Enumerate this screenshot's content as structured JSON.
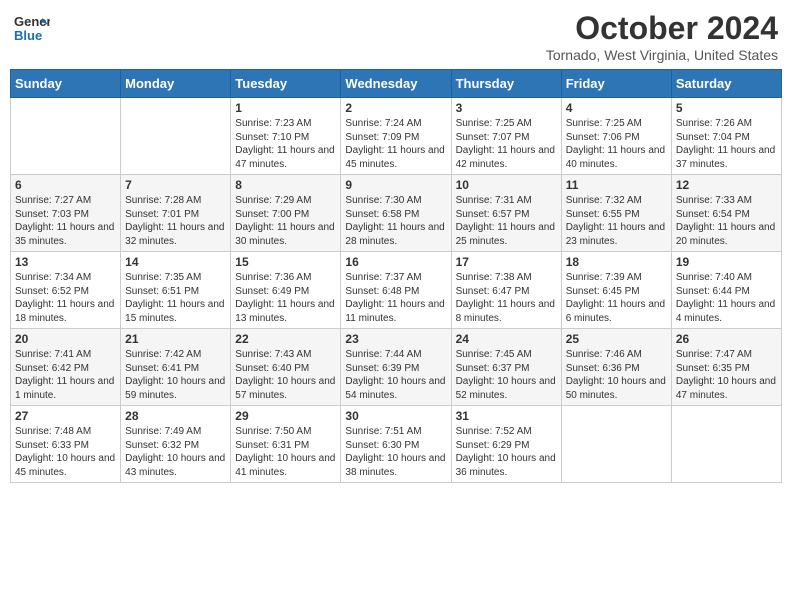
{
  "header": {
    "logo_line1": "General",
    "logo_line2": "Blue",
    "month": "October 2024",
    "location": "Tornado, West Virginia, United States"
  },
  "weekdays": [
    "Sunday",
    "Monday",
    "Tuesday",
    "Wednesday",
    "Thursday",
    "Friday",
    "Saturday"
  ],
  "weeks": [
    [
      {
        "day": "",
        "sunrise": "",
        "sunset": "",
        "daylight": ""
      },
      {
        "day": "",
        "sunrise": "",
        "sunset": "",
        "daylight": ""
      },
      {
        "day": "1",
        "sunrise": "Sunrise: 7:23 AM",
        "sunset": "Sunset: 7:10 PM",
        "daylight": "Daylight: 11 hours and 47 minutes."
      },
      {
        "day": "2",
        "sunrise": "Sunrise: 7:24 AM",
        "sunset": "Sunset: 7:09 PM",
        "daylight": "Daylight: 11 hours and 45 minutes."
      },
      {
        "day": "3",
        "sunrise": "Sunrise: 7:25 AM",
        "sunset": "Sunset: 7:07 PM",
        "daylight": "Daylight: 11 hours and 42 minutes."
      },
      {
        "day": "4",
        "sunrise": "Sunrise: 7:25 AM",
        "sunset": "Sunset: 7:06 PM",
        "daylight": "Daylight: 11 hours and 40 minutes."
      },
      {
        "day": "5",
        "sunrise": "Sunrise: 7:26 AM",
        "sunset": "Sunset: 7:04 PM",
        "daylight": "Daylight: 11 hours and 37 minutes."
      }
    ],
    [
      {
        "day": "6",
        "sunrise": "Sunrise: 7:27 AM",
        "sunset": "Sunset: 7:03 PM",
        "daylight": "Daylight: 11 hours and 35 minutes."
      },
      {
        "day": "7",
        "sunrise": "Sunrise: 7:28 AM",
        "sunset": "Sunset: 7:01 PM",
        "daylight": "Daylight: 11 hours and 32 minutes."
      },
      {
        "day": "8",
        "sunrise": "Sunrise: 7:29 AM",
        "sunset": "Sunset: 7:00 PM",
        "daylight": "Daylight: 11 hours and 30 minutes."
      },
      {
        "day": "9",
        "sunrise": "Sunrise: 7:30 AM",
        "sunset": "Sunset: 6:58 PM",
        "daylight": "Daylight: 11 hours and 28 minutes."
      },
      {
        "day": "10",
        "sunrise": "Sunrise: 7:31 AM",
        "sunset": "Sunset: 6:57 PM",
        "daylight": "Daylight: 11 hours and 25 minutes."
      },
      {
        "day": "11",
        "sunrise": "Sunrise: 7:32 AM",
        "sunset": "Sunset: 6:55 PM",
        "daylight": "Daylight: 11 hours and 23 minutes."
      },
      {
        "day": "12",
        "sunrise": "Sunrise: 7:33 AM",
        "sunset": "Sunset: 6:54 PM",
        "daylight": "Daylight: 11 hours and 20 minutes."
      }
    ],
    [
      {
        "day": "13",
        "sunrise": "Sunrise: 7:34 AM",
        "sunset": "Sunset: 6:52 PM",
        "daylight": "Daylight: 11 hours and 18 minutes."
      },
      {
        "day": "14",
        "sunrise": "Sunrise: 7:35 AM",
        "sunset": "Sunset: 6:51 PM",
        "daylight": "Daylight: 11 hours and 15 minutes."
      },
      {
        "day": "15",
        "sunrise": "Sunrise: 7:36 AM",
        "sunset": "Sunset: 6:49 PM",
        "daylight": "Daylight: 11 hours and 13 minutes."
      },
      {
        "day": "16",
        "sunrise": "Sunrise: 7:37 AM",
        "sunset": "Sunset: 6:48 PM",
        "daylight": "Daylight: 11 hours and 11 minutes."
      },
      {
        "day": "17",
        "sunrise": "Sunrise: 7:38 AM",
        "sunset": "Sunset: 6:47 PM",
        "daylight": "Daylight: 11 hours and 8 minutes."
      },
      {
        "day": "18",
        "sunrise": "Sunrise: 7:39 AM",
        "sunset": "Sunset: 6:45 PM",
        "daylight": "Daylight: 11 hours and 6 minutes."
      },
      {
        "day": "19",
        "sunrise": "Sunrise: 7:40 AM",
        "sunset": "Sunset: 6:44 PM",
        "daylight": "Daylight: 11 hours and 4 minutes."
      }
    ],
    [
      {
        "day": "20",
        "sunrise": "Sunrise: 7:41 AM",
        "sunset": "Sunset: 6:42 PM",
        "daylight": "Daylight: 11 hours and 1 minute."
      },
      {
        "day": "21",
        "sunrise": "Sunrise: 7:42 AM",
        "sunset": "Sunset: 6:41 PM",
        "daylight": "Daylight: 10 hours and 59 minutes."
      },
      {
        "day": "22",
        "sunrise": "Sunrise: 7:43 AM",
        "sunset": "Sunset: 6:40 PM",
        "daylight": "Daylight: 10 hours and 57 minutes."
      },
      {
        "day": "23",
        "sunrise": "Sunrise: 7:44 AM",
        "sunset": "Sunset: 6:39 PM",
        "daylight": "Daylight: 10 hours and 54 minutes."
      },
      {
        "day": "24",
        "sunrise": "Sunrise: 7:45 AM",
        "sunset": "Sunset: 6:37 PM",
        "daylight": "Daylight: 10 hours and 52 minutes."
      },
      {
        "day": "25",
        "sunrise": "Sunrise: 7:46 AM",
        "sunset": "Sunset: 6:36 PM",
        "daylight": "Daylight: 10 hours and 50 minutes."
      },
      {
        "day": "26",
        "sunrise": "Sunrise: 7:47 AM",
        "sunset": "Sunset: 6:35 PM",
        "daylight": "Daylight: 10 hours and 47 minutes."
      }
    ],
    [
      {
        "day": "27",
        "sunrise": "Sunrise: 7:48 AM",
        "sunset": "Sunset: 6:33 PM",
        "daylight": "Daylight: 10 hours and 45 minutes."
      },
      {
        "day": "28",
        "sunrise": "Sunrise: 7:49 AM",
        "sunset": "Sunset: 6:32 PM",
        "daylight": "Daylight: 10 hours and 43 minutes."
      },
      {
        "day": "29",
        "sunrise": "Sunrise: 7:50 AM",
        "sunset": "Sunset: 6:31 PM",
        "daylight": "Daylight: 10 hours and 41 minutes."
      },
      {
        "day": "30",
        "sunrise": "Sunrise: 7:51 AM",
        "sunset": "Sunset: 6:30 PM",
        "daylight": "Daylight: 10 hours and 38 minutes."
      },
      {
        "day": "31",
        "sunrise": "Sunrise: 7:52 AM",
        "sunset": "Sunset: 6:29 PM",
        "daylight": "Daylight: 10 hours and 36 minutes."
      },
      {
        "day": "",
        "sunrise": "",
        "sunset": "",
        "daylight": ""
      },
      {
        "day": "",
        "sunrise": "",
        "sunset": "",
        "daylight": ""
      }
    ]
  ]
}
